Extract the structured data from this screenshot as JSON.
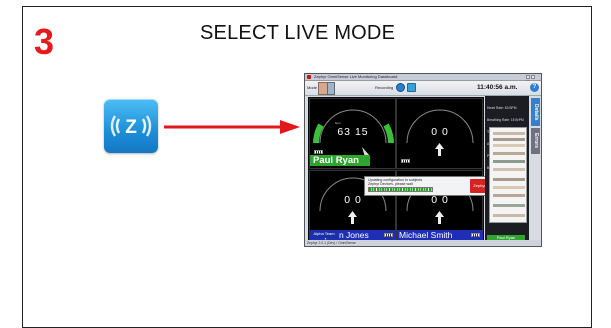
{
  "slide": {
    "step_number": "3",
    "title": "SELECT LIVE MODE"
  },
  "app_icon": {
    "name": "live-mode-icon",
    "glyph": "Z"
  },
  "colors": {
    "step_red": "#e8191b",
    "arrow_red": "#e2171b",
    "live_green": "#2fa52f",
    "team_blue": "#1e2fb5"
  },
  "screenshot": {
    "window_title": "Zephyr OmniSense Live Monitoring Dashboard",
    "toolbar": {
      "menu_label": "Mode",
      "recording_label": "Recording",
      "clock": "11:40:56 a.m.",
      "help": "?"
    },
    "gauges": [
      {
        "left_value": "63",
        "right_value": "15",
        "name": "Paul Ryan"
      },
      {
        "left_value": "0",
        "right_value": "0",
        "name": ""
      },
      {
        "left_value": "0",
        "right_value": "0",
        "name": "Stephen Jones"
      },
      {
        "left_value": "0",
        "right_value": "0",
        "name": "Michael Smith"
      }
    ],
    "gauge_unit": "bpm",
    "dialog": {
      "message_line1": "Updating configuration to subjects",
      "message_line2": "Zephyr Devices, please wait",
      "button_label": "Zephyr"
    },
    "side_panel": {
      "info_lines": [
        "Heart Rate: 63 BPM",
        "Breathing Rate: 15 BrPM",
        "Temperature: 36.5 C",
        "Activity: 0.1 g (Rest)",
        "Posture: -9 Degrees",
        "Battery: 100%"
      ],
      "selected_name": "Paul Ryan",
      "tabs": [
        "Details",
        "Errors"
      ]
    },
    "team_tab": "Alpha Team",
    "status_bar": "Zephyr 2.0.1 (Dev) / OmniSense"
  }
}
